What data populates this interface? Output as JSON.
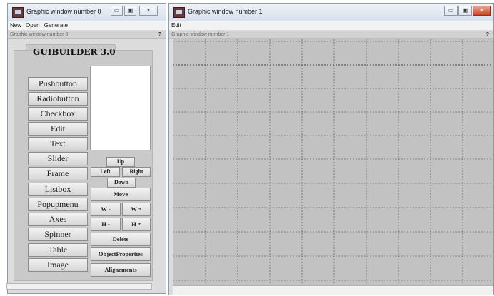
{
  "window0": {
    "title": "Graphic window number 0",
    "controls": [
      "▭",
      "▣",
      "✕"
    ],
    "menu": [
      "New",
      "Open",
      "Generate"
    ],
    "subtitle": "Graphic window number 0",
    "help": "?",
    "app_title": "GUIBUILDER 3.0",
    "components": [
      "Pushbutton",
      "Radiobutton",
      "Checkbox",
      "Edit",
      "Text",
      "Slider",
      "Frame",
      "Listbox",
      "Popupmenu",
      "Axes",
      "Spinner",
      "Table",
      "Image"
    ],
    "nav": {
      "up": "Up",
      "left": "Left",
      "right": "Right",
      "down": "Down"
    },
    "move": "Move",
    "w_minus": "W -",
    "w_plus": "W +",
    "h_minus": "H -",
    "h_plus": "H +",
    "delete": "Delete",
    "object_properties": "ObjectProperties",
    "alignements": "Alignements"
  },
  "window1": {
    "title": "Graphic window number 1",
    "controls": [
      "▭",
      "▣",
      "✕"
    ],
    "menu": [
      "Edit"
    ],
    "subtitle": "Graphic window number 1",
    "help": "?"
  },
  "colors": {
    "canvas": "#c2c2c2",
    "grid": "#444444",
    "panel": "#c9c9c9"
  }
}
